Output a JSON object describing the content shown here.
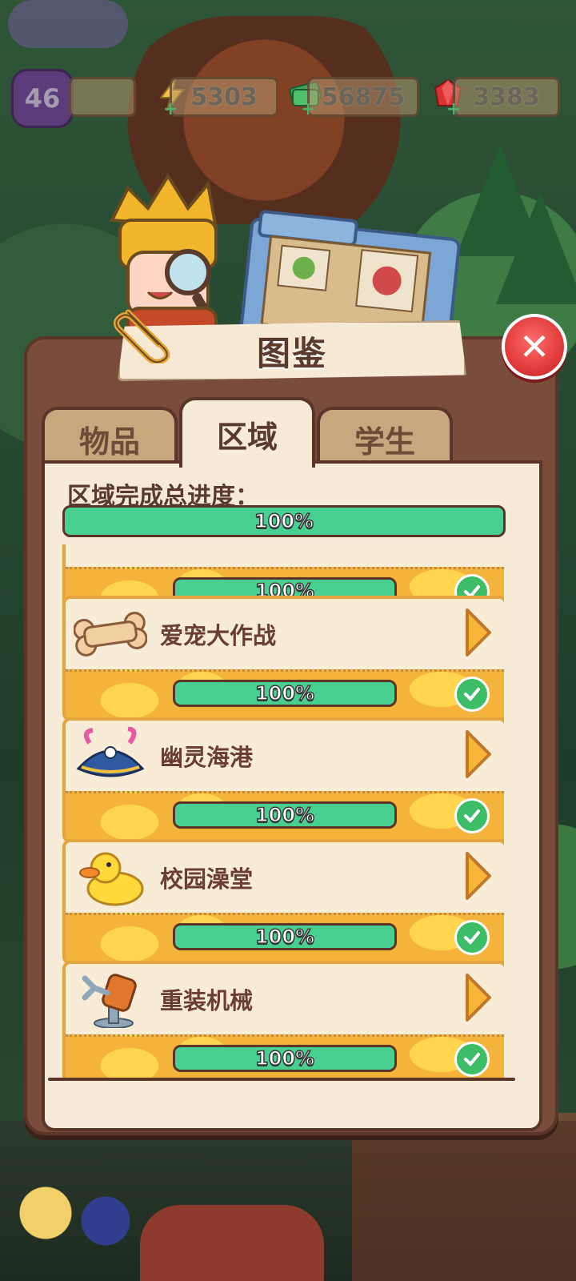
{
  "hud": {
    "level": "46",
    "energy": "5303",
    "cash": "56875",
    "gems": "3383"
  },
  "title": "图鉴",
  "tabs": [
    {
      "label": "物品",
      "active": false
    },
    {
      "label": "区域",
      "active": true
    },
    {
      "label": "学生",
      "active": false
    }
  ],
  "summary": {
    "label": "区域完成总进度：",
    "progress_text": "100%",
    "progress_value": 1.0
  },
  "areas": [
    {
      "name": "",
      "progress_text": "100%",
      "progress_value": 1.0,
      "icon": "area-icon"
    },
    {
      "name": "爱宠大作战",
      "progress_text": "100%",
      "progress_value": 1.0,
      "icon": "bone-icon"
    },
    {
      "name": "幽灵海港",
      "progress_text": "100%",
      "progress_value": 1.0,
      "icon": "pirate-hat-icon"
    },
    {
      "name": "校园澡堂",
      "progress_text": "100%",
      "progress_value": 1.0,
      "icon": "rubber-duck-icon"
    },
    {
      "name": "重装机械",
      "progress_text": "100%",
      "progress_value": 1.0,
      "icon": "robot-arm-icon"
    }
  ],
  "colors": {
    "panel": "#7a4c3c",
    "content": "#f7ebd8",
    "progress": "#47d08f",
    "card_border": "#e3a33d",
    "close": "#e23b3b"
  }
}
